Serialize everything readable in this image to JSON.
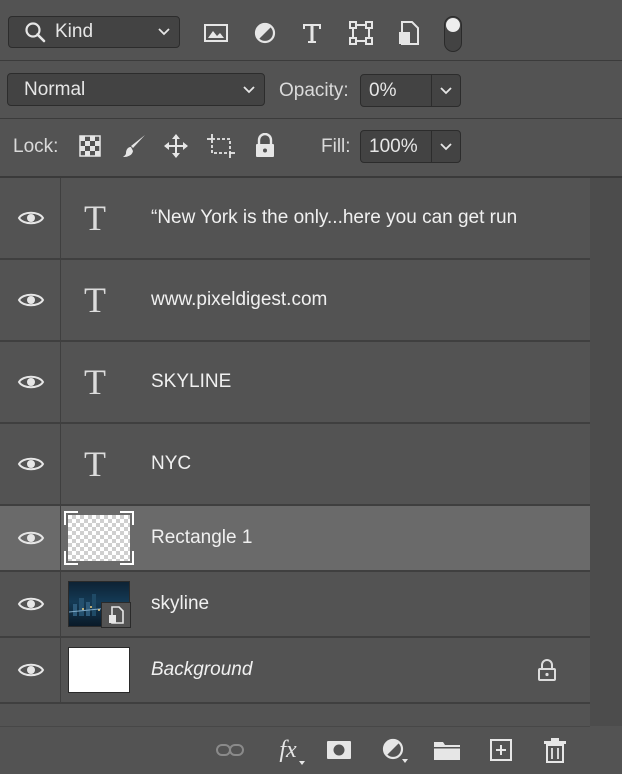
{
  "filter": {
    "kind_label": "Kind",
    "icons": [
      "image-filter-icon",
      "adjustment-filter-icon",
      "type-filter-icon",
      "shape-filter-icon",
      "smart-object-filter-icon"
    ]
  },
  "blend": {
    "mode": "Normal",
    "opacity_label": "Opacity:",
    "opacity_value": "0%"
  },
  "lock": {
    "label": "Lock:",
    "fill_label": "Fill:",
    "fill_value": "100%"
  },
  "layers": [
    {
      "name": "“New York is the only...here you can get run",
      "kind": "text",
      "visible": true
    },
    {
      "name": "www.pixeldigest.com",
      "kind": "text",
      "visible": true
    },
    {
      "name": "SKYLINE",
      "kind": "text",
      "visible": true
    },
    {
      "name": "NYC",
      "kind": "text",
      "visible": true
    },
    {
      "name": "Rectangle 1",
      "kind": "shape",
      "visible": true,
      "selected": true
    },
    {
      "name": "skyline",
      "kind": "smart-object",
      "visible": true
    },
    {
      "name": "Background",
      "kind": "background",
      "visible": true,
      "locked": true
    }
  ],
  "bottom_bar": {
    "icons": [
      "link-layers-icon",
      "fx-icon",
      "add-mask-icon",
      "adjustment-layer-icon",
      "new-group-icon",
      "new-layer-icon",
      "delete-layer-icon"
    ],
    "fx_label": "fx"
  },
  "colors": {
    "panel": "#535353",
    "selected_row": "#6a6a6a",
    "field": "#434343"
  }
}
